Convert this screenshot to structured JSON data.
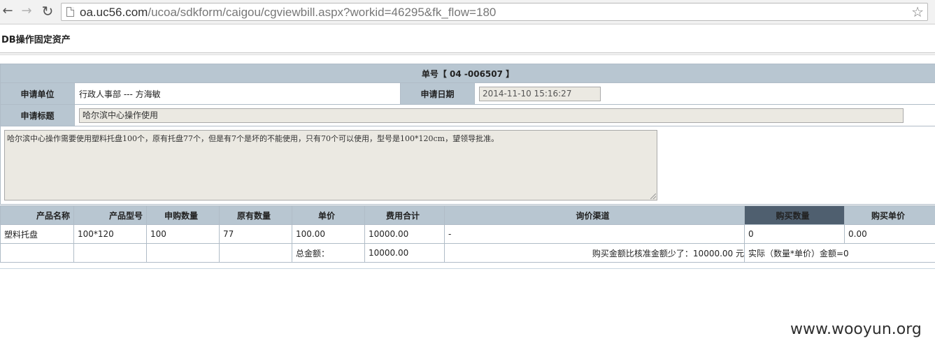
{
  "browser": {
    "url_host": "oa.uc56.com",
    "url_path": "/ucoa/sdkform/caigou/cgviewbill.aspx?workid=46295&fk_flow=180"
  },
  "page": {
    "title": "DB操作固定资产"
  },
  "form": {
    "bill_number": "单号【 04 -006507 】",
    "applicant_unit_label": "申请单位",
    "applicant_unit_value": "行政人事部 --- 方海敏",
    "apply_date_label": "申请日期",
    "apply_date_value": "2014-11-10 15:16:27",
    "apply_title_label": "申请标题",
    "apply_title_value": "哈尔滨中心操作使用",
    "description": "哈尔滨中心操作需要使用塑料托盘100个，原有托盘77个，但是有7个是坏的不能使用，只有70个可以使用，型号是100*120cm，望领导批准。"
  },
  "products": {
    "headers": [
      "产品名称",
      "产品型号",
      "申购数量",
      "原有数量",
      "单价",
      "费用合计",
      "询价渠道",
      "购买数量",
      "购买单价"
    ],
    "rows": [
      [
        "塑料托盘",
        "100*120",
        "100",
        "77",
        "100.00",
        "10000.00",
        "-",
        "0",
        "0.00"
      ]
    ],
    "total_label": "总金额：",
    "total_value": "10000.00",
    "diff_note": "购买金额比核准金额少了：10000.00 元",
    "actual_note": "实际（数量*单价）金额=0"
  },
  "watermark": "www.wooyun.org"
}
